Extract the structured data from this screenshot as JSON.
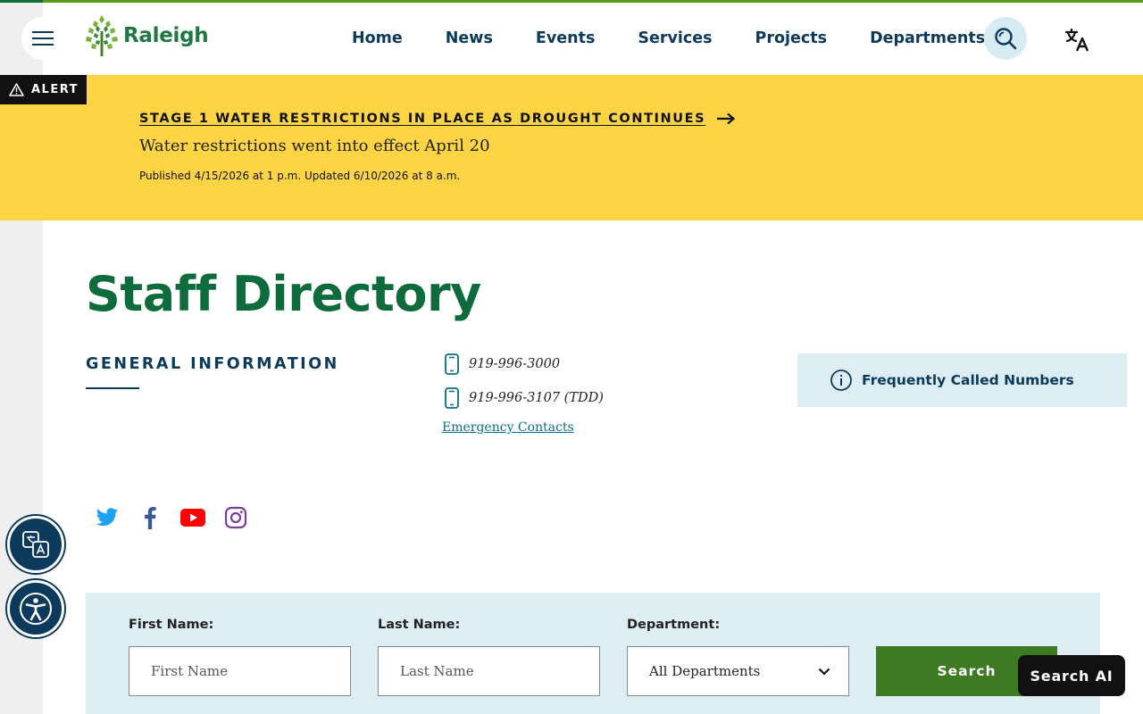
{
  "header": {
    "logo_text": "Raleigh",
    "nav": [
      {
        "label": "Home"
      },
      {
        "label": "News"
      },
      {
        "label": "Events"
      },
      {
        "label": "Services"
      },
      {
        "label": "Projects"
      },
      {
        "label": "Departments"
      }
    ],
    "icons": {
      "menu": "hamburger-icon",
      "search": "search-icon",
      "translate": "translate-icon"
    }
  },
  "alert": {
    "tag": "ALERT",
    "headline": "STAGE 1 WATER RESTRICTIONS IN PLACE AS DROUGHT CONTINUES",
    "subtitle": "Water restrictions went into effect April 20",
    "meta": "Published 4/15/2026 at 1 p.m.  Updated 6/10/2026 at 8 a.m.",
    "color": "#fdd444"
  },
  "page": {
    "title": "Staff Directory",
    "general_info_heading": "GENERAL INFORMATION",
    "phones": [
      {
        "number": "919-996-3000"
      },
      {
        "number": "919-996-3107 (TDD)"
      }
    ],
    "emergency_link": "Emergency Contacts",
    "frequently_called": "Frequently Called Numbers"
  },
  "social": [
    "twitter-icon",
    "facebook-icon",
    "youtube-icon",
    "instagram-icon"
  ],
  "search_form": {
    "first_name_label": "First Name:",
    "first_name_placeholder": "First Name",
    "last_name_label": "Last Name:",
    "last_name_placeholder": "Last Name",
    "department_label": "Department:",
    "department_value": "All Departments",
    "submit_label": "Search"
  },
  "search_ai_label": "Search AI",
  "colors": {
    "brand_green": "#0e6b3b",
    "navy": "#0c3a5c",
    "button_green": "#3d7a22",
    "panel_blue": "#deedf3"
  }
}
